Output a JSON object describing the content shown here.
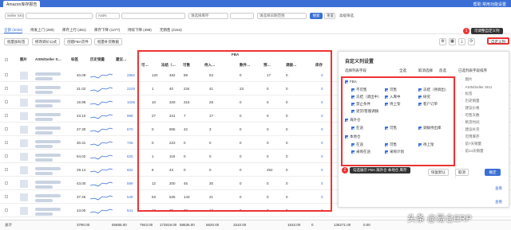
{
  "tabbar": {
    "tab_label": "Amazon库存报告",
    "right_text": "帮助   常用功能设置"
  },
  "filters": {
    "site": "Seller SKU",
    "asin": "ASIN",
    "inventory": "请选择库存",
    "date": "请选择日期范围",
    "search_label": "搜索",
    "reset_label": "重置",
    "advanced": "高级筛选"
  },
  "status_tabs": [
    {
      "label": "全部 (3036)"
    },
    {
      "label": "待发上门 (280)"
    },
    {
      "label": "库存上行 (481)"
    },
    {
      "label": "库存下降 (1277)"
    },
    {
      "label": "持续下降 (488)"
    },
    {
      "label": "无销售 (2154)"
    }
  ],
  "actions": {
    "a1": "批量加标签",
    "a2": "修改调价公式",
    "a3": "创建FBA货件",
    "a4": "批量补货数据",
    "custom": "自定义列"
  },
  "annotation1": {
    "num": "1",
    "text": "可调整自定义列"
  },
  "annotation2": {
    "num": "2",
    "text": "勾选展示 FBA 海外仓 本地仓 库存"
  },
  "headers": {
    "pic": "图片",
    "asin": "ASIN/Seller S…",
    "tag": "标签",
    "trend": "历史销量",
    "price": "建议…",
    "fba": "FBA",
    "f1": "可…",
    "f2": "冻结（…",
    "f3": "可售",
    "f4": "待入…",
    "f5": "数件…",
    "f6": "预…",
    "f7": "调拨…",
    "f8": "库存"
  },
  "rows": [
    {
      "a": "40.09",
      "b": "2892",
      "c": "120",
      "d": "462",
      "e": "89",
      "f": "53",
      "g": "0",
      "h": "17",
      "i": "0",
      "stock": "0"
    },
    {
      "a": "31.02",
      "b": "2229",
      "c": "1",
      "d": "40",
      "e": "234",
      "f": "41",
      "g": "23",
      "h": "0",
      "i": "0",
      "stock": "0"
    },
    {
      "a": "19.99",
      "b": "1006",
      "c": "10",
      "d": "329",
      "e": "316",
      "f": "28",
      "g": "0",
      "h": "0",
      "i": "0",
      "stock": "0"
    },
    {
      "a": "43.10",
      "b": "988",
      "c": "27",
      "d": "341",
      "e": "7",
      "f": "17",
      "g": "0",
      "h": "0",
      "i": "0",
      "stock": "0"
    },
    {
      "a": "27.30",
      "b": "870",
      "c": "0",
      "d": "905",
      "e": "42",
      "f": "3",
      "g": "0",
      "h": "0",
      "i": "0",
      "stock": "0"
    },
    {
      "a": "30.31",
      "b": "726",
      "c": "0",
      "d": "223",
      "e": "0",
      "f": "0",
      "g": "0",
      "h": "0",
      "i": "0",
      "stock": "0"
    },
    {
      "a": "64.02",
      "b": "625",
      "c": "1",
      "d": "119",
      "e": "0",
      "f": "0",
      "g": "0",
      "h": "0",
      "i": "0",
      "stock": "0"
    },
    {
      "a": "29.14",
      "b": "602",
      "c": "8",
      "d": "43",
      "e": "0",
      "f": "0",
      "g": "0",
      "h": "252",
      "i": "0",
      "stock": "0"
    },
    {
      "a": "43.00",
      "b": "599",
      "c": "12",
      "d": "200",
      "e": "45",
      "f": "30",
      "g": "0",
      "h": "0",
      "i": "0",
      "stock": "0"
    },
    {
      "a": "37.46",
      "b": "549",
      "c": "53",
      "d": "525",
      "e": "143",
      "f": "21",
      "g": "0",
      "h": "0",
      "i": "0",
      "stock": "0"
    },
    {
      "a": "43.00",
      "b": "541",
      "c": "10",
      "d": "30",
      "e": "72",
      "f": "12",
      "g": "0",
      "h": "0",
      "i": "0",
      "stock": "0"
    }
  ],
  "totals": {
    "label": "总计",
    "v1": "3790.00",
    "v2": "55685.00",
    "v3": "7943.00",
    "v4": "172819.00",
    "v5": "58536.00",
    "v6": "5620.00",
    "v7": "1510.00",
    "v8": "1810.00",
    "v9": "0",
    "v10": "136271.00",
    "v11": "0.00"
  },
  "panel": {
    "title": "自定义列设置",
    "sub": "选择列表字段",
    "cols": [
      "全选",
      "取消选择",
      "反选"
    ],
    "right_title": "已选列表字段排序",
    "fba_group": "FBA",
    "fba_items": [
      "不可售",
      "可售",
      "冻结（待调出）",
      "冻结（调出中）",
      "入库中",
      "研究",
      "禁止条件",
      "待上架",
      "客户订单",
      "退货/客服调拨"
    ],
    "overseas_group": "海外仓",
    "overseas_items": [
      "在途",
      "可售",
      "调拨待出库"
    ],
    "local_group": "本地仓",
    "local_items": [
      "在途",
      "可售",
      "待上架",
      "采购在途",
      "采购计划"
    ],
    "right_items": [
      "图片",
      "ASIN/Seller SKU",
      "标签",
      "历史销量",
      "建议价格",
      "可售天数",
      "断货时间",
      "建议补货",
      "可用库存",
      "前7天销量",
      "前14天销量"
    ],
    "btn_default": "恢复默认",
    "btn_cancel": "取消",
    "btn_ok": "确定",
    "more": "查看"
  },
  "watermark": "头条 @易仓ERP"
}
